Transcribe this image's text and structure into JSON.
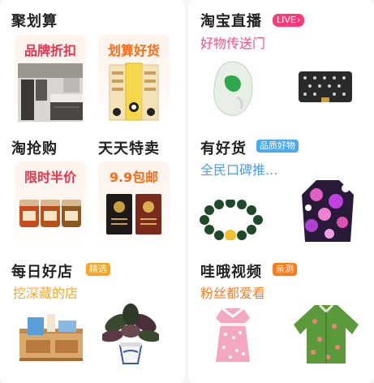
{
  "left": {
    "juhuasuan": {
      "title": "聚划算",
      "card1_label": "品牌折扣",
      "card2_label": "划算好货"
    },
    "taoqianggou": {
      "title": "淘抢购",
      "card_label": "限时半价"
    },
    "tiantiantemai": {
      "title": "天天特卖",
      "card_label": "9.9包邮"
    },
    "meirihaodian": {
      "title": "每日好店",
      "badge": "精选",
      "subtitle": "挖深藏的店"
    }
  },
  "right": {
    "taobaozhibo": {
      "title": "淘宝直播",
      "badge": "LIVE",
      "subtitle": "好物传送门"
    },
    "youhaohuo": {
      "title": "有好货",
      "badge": "品质好物",
      "subtitle": "全民口碑推..."
    },
    "waoshipin": {
      "title": "哇哦视频",
      "badge": "亲测",
      "subtitle": "粉丝都爱看"
    }
  },
  "colors": {
    "card_label_red": "#f0304a",
    "card_label_orange": "#ff6a13",
    "live_pink": "#ff3a7a",
    "subtitle_pink": "#ff4a86",
    "subtitle_blue": "#4a9ef0",
    "subtitle_orange": "#ff7a1a",
    "subtitle_yellow": "#f5a623"
  },
  "icons": [
    "live-play-icon"
  ]
}
